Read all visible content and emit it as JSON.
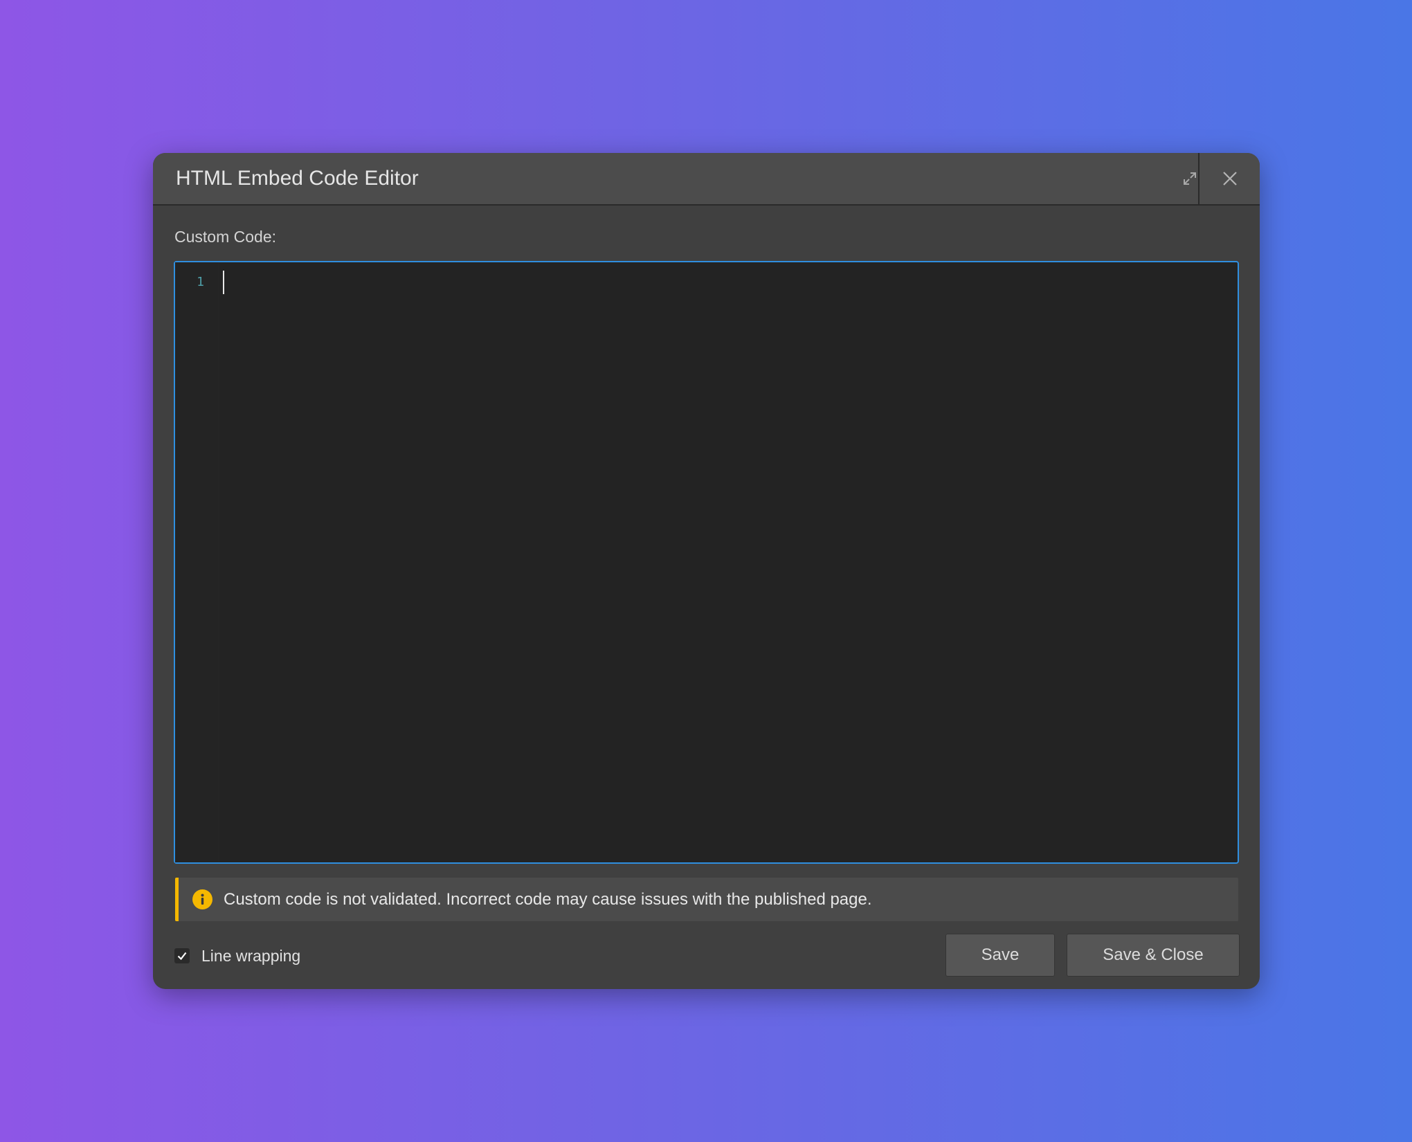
{
  "dialog": {
    "title": "HTML Embed Code Editor",
    "expand_icon": "expand-icon",
    "close_icon": "close-icon"
  },
  "editor": {
    "label": "Custom Code:",
    "line_numbers": [
      "1"
    ],
    "content": "",
    "focus_color": "#2f8fe0"
  },
  "warning": {
    "icon": "info-icon",
    "text": "Custom code is not validated. Incorrect code may cause issues with the published page.",
    "accent_color": "#f5b800"
  },
  "footer": {
    "line_wrapping_label": "Line wrapping",
    "line_wrapping_checked": true,
    "save_label": "Save",
    "save_close_label": "Save & Close"
  }
}
